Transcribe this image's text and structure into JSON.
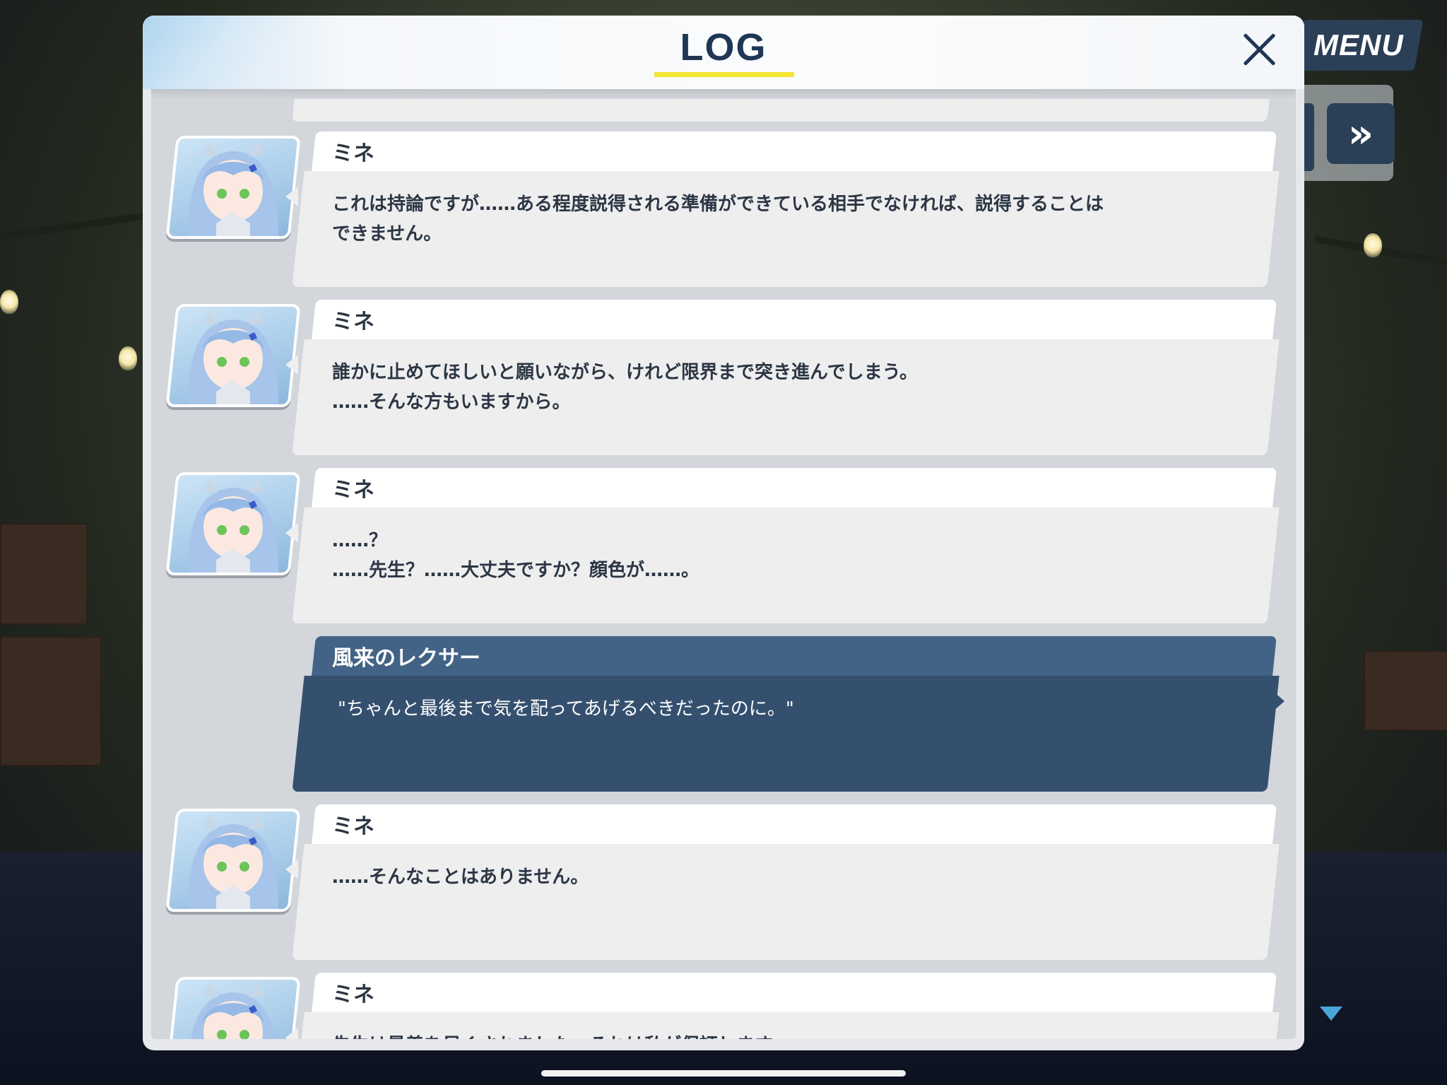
{
  "header": {
    "title": "LOG"
  },
  "controls": {
    "menu_label": "MENU",
    "skip_label": "»"
  },
  "log": {
    "entries": [
      {
        "speaker": "ミネ",
        "lines": [
          "これは持論ですが……ある程度説得される準備ができている相手でなければ、説得することは",
          "できません。"
        ]
      },
      {
        "speaker": "ミネ",
        "lines": [
          "誰かに止めてほしいと願いながら、けれど限界まで突き進んでしまう。",
          "……そんな方もいますから。"
        ]
      },
      {
        "speaker": "ミネ",
        "lines": [
          "……？",
          "……先生？……大丈夫ですか？顔色が……。"
        ]
      },
      {
        "speaker": "風来のレクサー",
        "lines": [
          "\"ちゃんと最後まで気を配ってあげるべきだったのに。\""
        ]
      },
      {
        "speaker": "ミネ",
        "lines": [
          "……そんなことはありません。"
        ]
      },
      {
        "speaker": "ミネ",
        "lines": [
          "先生は最善を尽くされました。それは私が保証します。"
        ]
      }
    ]
  },
  "colors": {
    "header_title": "#1f3654",
    "underline": "#f3e532",
    "self_bubble": "#35506f",
    "npc_bubble": "#eeeeef",
    "menu": "#2b3f56"
  },
  "icons": {
    "close": "close-icon",
    "skip": "fast-forward-icon",
    "scroll": "scroll-down-icon"
  }
}
